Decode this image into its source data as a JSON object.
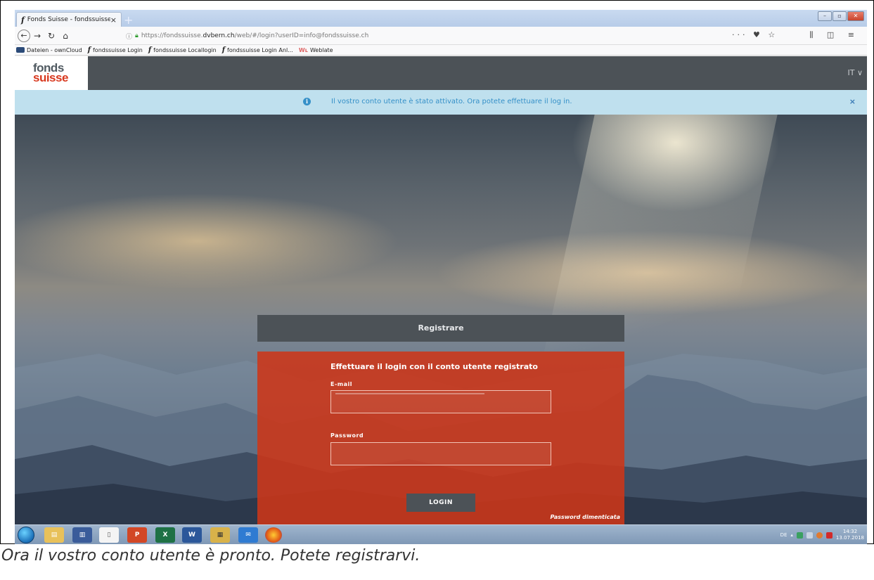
{
  "browser": {
    "tab_title": "Fonds Suisse - fondssuisse",
    "tab_close": "×",
    "new_tab": "+",
    "url_prefix": "https://fondssuisse.",
    "url_host": "dvbern.ch",
    "url_path": "/web/#/login?userID=info@fondssuisse.ch",
    "page_actions": "··· ♥ ☆",
    "toolbar_icons": "⫼ ◫ ≡"
  },
  "bookmarks": [
    {
      "label": "Dateien - ownCloud",
      "icon": "cloud-icon"
    },
    {
      "label": "fondssuisse Login",
      "icon": "fondssuisse-icon"
    },
    {
      "label": "fondssuisse Locallogin",
      "icon": "fondssuisse-icon"
    },
    {
      "label": "fondssuisse Login Anl...",
      "icon": "fondssuisse-icon"
    },
    {
      "label": "Weblate",
      "icon": "weblate-icon"
    }
  ],
  "site": {
    "logo_top": "fonds",
    "logo_bottom": "suisse",
    "language": "IT ∨",
    "colors": {
      "header": "#4c5257",
      "accent": "#cd3618",
      "banner_bg": "#bfe0ee",
      "banner_text": "#3590c8"
    }
  },
  "banner": {
    "icon": "info-icon",
    "message": "Il vostro conto utente è stato attivato. Ora potete effettuare il log in.",
    "close": "×"
  },
  "login": {
    "header": "Registrare",
    "title": "Effettuare il login con il conto utente registrato",
    "email_label": "E-mail",
    "email_value": "",
    "password_label": "Password",
    "password_value": "",
    "button": "LOGIN",
    "forgot": "Password dimenticata"
  },
  "taskbar": {
    "language": "DE",
    "time": "14:32",
    "date": "13.07.2018"
  },
  "caption": "Ora il vostro conto utente è pronto. Potete registrarvi."
}
